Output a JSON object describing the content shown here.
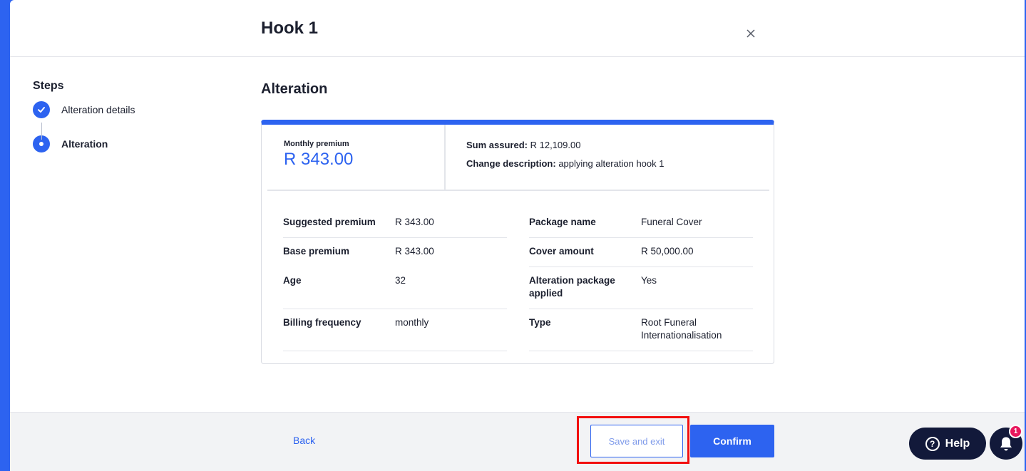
{
  "header": {
    "title": "Hook 1"
  },
  "steps": {
    "heading": "Steps",
    "items": [
      {
        "label": "Alteration details",
        "state": "completed"
      },
      {
        "label": "Alteration",
        "state": "current"
      }
    ]
  },
  "section": {
    "title": "Alteration"
  },
  "summary": {
    "monthly_premium_label": "Monthly premium",
    "monthly_premium_value": "R 343.00",
    "sum_assured_label": "Sum assured:",
    "sum_assured_value": "R 12,109.00",
    "change_description_label": "Change description:",
    "change_description_value": "applying alteration hook 1"
  },
  "details": {
    "left": [
      {
        "key": "Suggested premium",
        "value": "R 343.00"
      },
      {
        "key": "Base premium",
        "value": "R 343.00"
      },
      {
        "key": "Age",
        "value": "32"
      },
      {
        "key": "Billing frequency",
        "value": "monthly"
      }
    ],
    "right": [
      {
        "key": "Package name",
        "value": "Funeral Cover"
      },
      {
        "key": "Cover amount",
        "value": "R 50,000.00"
      },
      {
        "key": "Alteration package applied",
        "value": "Yes"
      },
      {
        "key": "Type",
        "value": "Root Funeral Internationalisation"
      }
    ]
  },
  "footer": {
    "back_label": "Back",
    "save_exit_label": "Save and exit",
    "confirm_label": "Confirm"
  },
  "widgets": {
    "help_label": "Help",
    "help_icon": "?",
    "notification_count": "1"
  },
  "colors": {
    "accent": "#2d63f0",
    "dark": "#12193a",
    "highlight": "#f20f0f",
    "badge": "#e8175d"
  }
}
